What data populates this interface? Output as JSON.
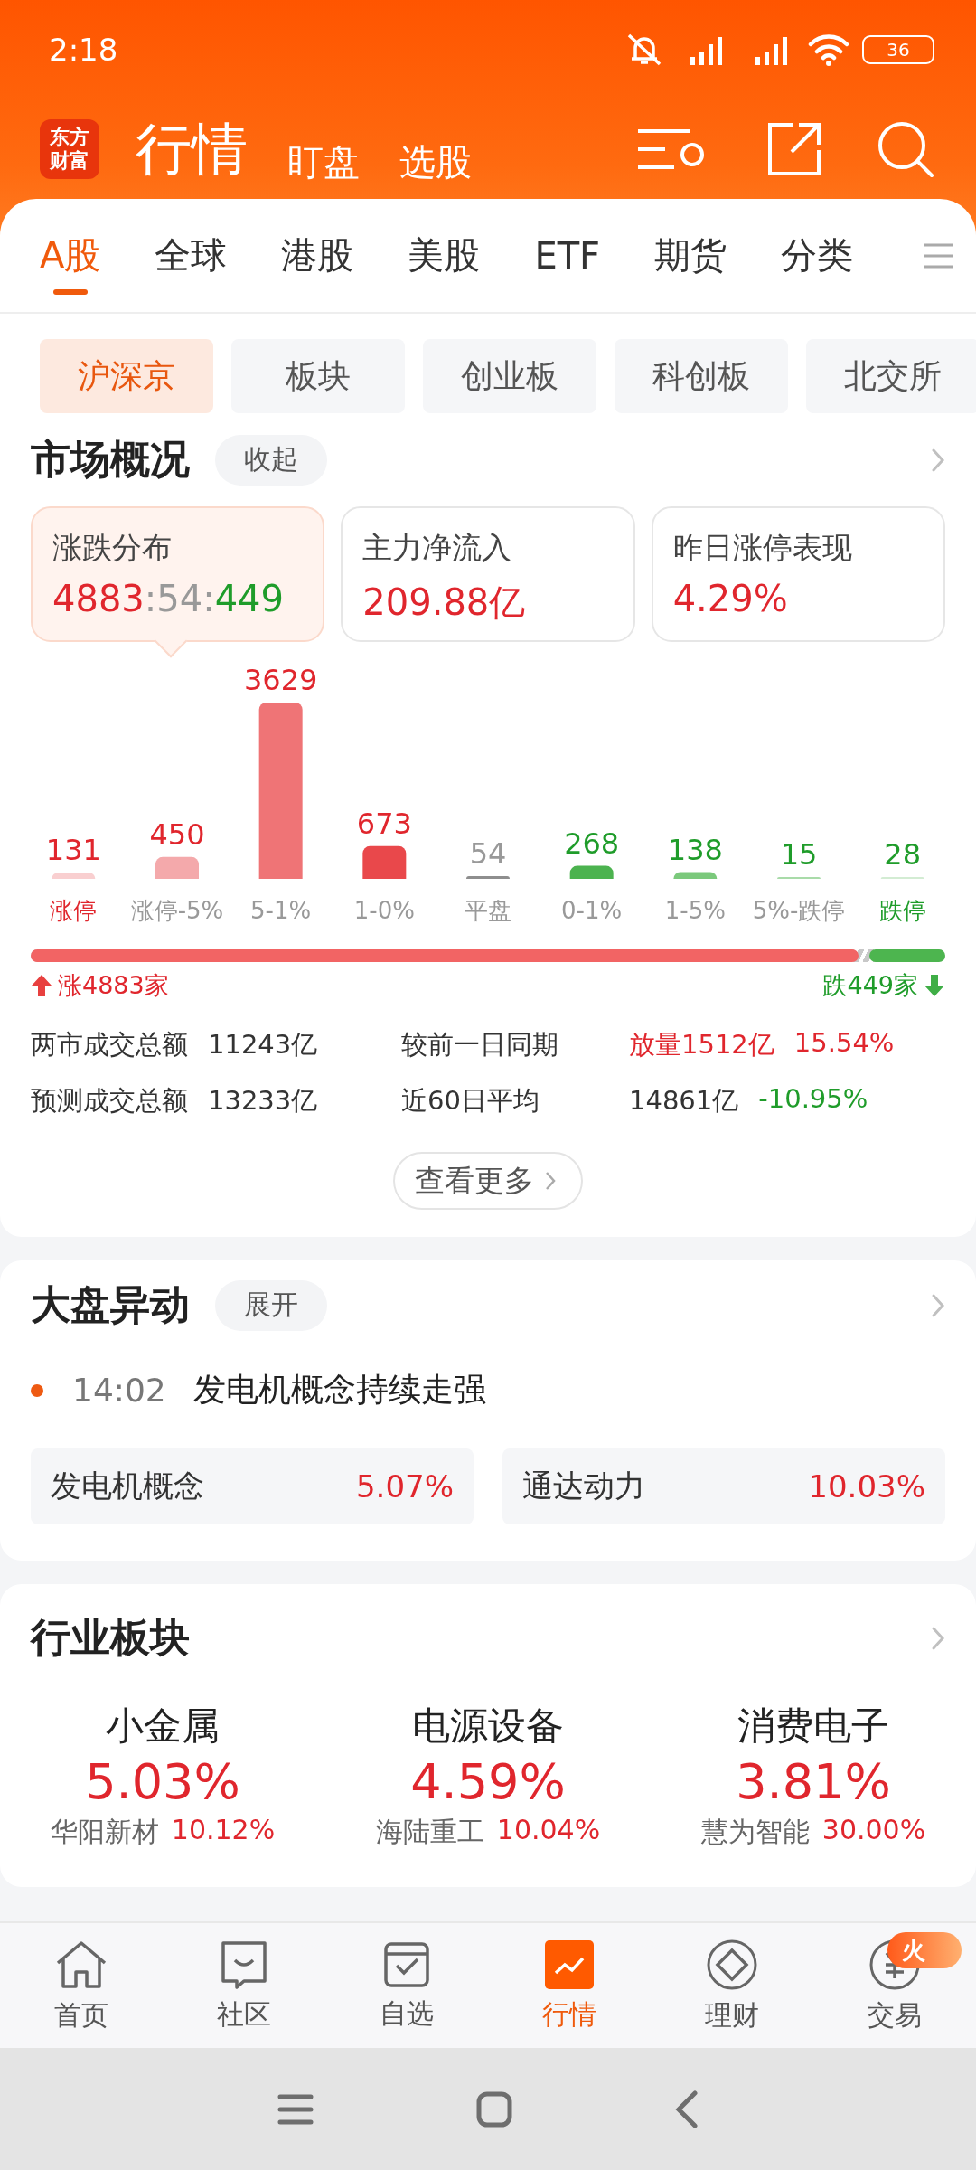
{
  "status_bar": {
    "time": "2:18",
    "battery": "36"
  },
  "header": {
    "logo_lines": [
      "东方",
      "财富"
    ],
    "tabs": [
      {
        "label": "行情",
        "selected": true
      },
      {
        "label": "盯盘",
        "selected": false
      },
      {
        "label": "选股",
        "selected": false
      }
    ]
  },
  "market_tabs": [
    {
      "label": "A股",
      "selected": true
    },
    {
      "label": "全球",
      "selected": false
    },
    {
      "label": "港股",
      "selected": false
    },
    {
      "label": "美股",
      "selected": false
    },
    {
      "label": "ETF",
      "selected": false
    },
    {
      "label": "期货",
      "selected": false
    },
    {
      "label": "分类",
      "selected": false
    }
  ],
  "sub_tabs": [
    {
      "label": "沪深京",
      "selected": true
    },
    {
      "label": "板块",
      "selected": false
    },
    {
      "label": "创业板",
      "selected": false
    },
    {
      "label": "科创板",
      "selected": false
    },
    {
      "label": "北交所",
      "selected": false
    }
  ],
  "overview": {
    "title": "市场概况",
    "toggle": "收起",
    "cards": [
      {
        "title": "涨跌分布",
        "selected": true,
        "value_parts": [
          {
            "text": "4883",
            "kind": "up"
          },
          {
            "text": ":54:",
            "kind": "flat"
          },
          {
            "text": "449",
            "kind": "down"
          }
        ]
      },
      {
        "title": "主力净流入",
        "selected": false,
        "value_parts": [
          {
            "text": "209.88亿",
            "kind": "up"
          }
        ]
      },
      {
        "title": "昨日涨停表现",
        "selected": false,
        "value_parts": [
          {
            "text": "4.29%",
            "kind": "up"
          }
        ]
      }
    ],
    "chart_data": {
      "type": "bar",
      "categories": [
        "涨停",
        "涨停-5%",
        "5-1%",
        "1-0%",
        "平盘",
        "0-1%",
        "1-5%",
        "5%-跌停",
        "跌停"
      ],
      "series": [
        {
          "values": [
            131,
            450,
            3629,
            673,
            54,
            268,
            138,
            15,
            28
          ]
        }
      ],
      "data_labels": true
    },
    "breadth": {
      "rise": {
        "label": "涨4883家",
        "level": 0.905
      },
      "fall": {
        "label": "跌449家",
        "level": 0.083
      }
    },
    "stats": [
      {
        "label": "两市成交总额",
        "value": "11243亿"
      },
      {
        "label": "较前一日同期",
        "value": "放量1512亿",
        "color": "#e0262d",
        "change": {
          "text": "15.54%",
          "color": "#e0262d"
        }
      },
      {
        "label": "预测成交总额",
        "value": "13233亿"
      },
      {
        "label": "近60日平均",
        "value": "14861亿",
        "change": {
          "text": "-10.95%",
          "color": "#1f9c2a"
        }
      }
    ],
    "more_button": "查看更多"
  },
  "alerts": {
    "title": "大盘异动",
    "toggle": "展开",
    "event": {
      "time": "14:02",
      "text": "发电机概念持续走强"
    },
    "chips": [
      {
        "name": "发电机概念",
        "change": "5.07%"
      },
      {
        "name": "通达动力",
        "change": "10.03%"
      }
    ]
  },
  "industry": {
    "title": "行业板块",
    "items": [
      {
        "name": "小金属",
        "change": "5.03%",
        "leader": "华阳新材",
        "leader_change": "10.12%"
      },
      {
        "name": "电源设备",
        "change": "4.59%",
        "leader": "海陆重工",
        "leader_change": "10.04%"
      },
      {
        "name": "消费电子",
        "change": "3.81%",
        "leader": "慧为智能",
        "leader_change": "30.00%"
      }
    ]
  },
  "bottom_nav": [
    {
      "label": "首页",
      "kind": "home",
      "selected": false
    },
    {
      "label": "社区",
      "kind": "community",
      "selected": false
    },
    {
      "label": "自选",
      "kind": "watchlist",
      "selected": false
    },
    {
      "label": "行情",
      "kind": "market",
      "selected": true
    },
    {
      "label": "理财",
      "kind": "wealth",
      "selected": false
    },
    {
      "label": "交易",
      "kind": "trade",
      "selected": false,
      "badge": "火"
    }
  ]
}
